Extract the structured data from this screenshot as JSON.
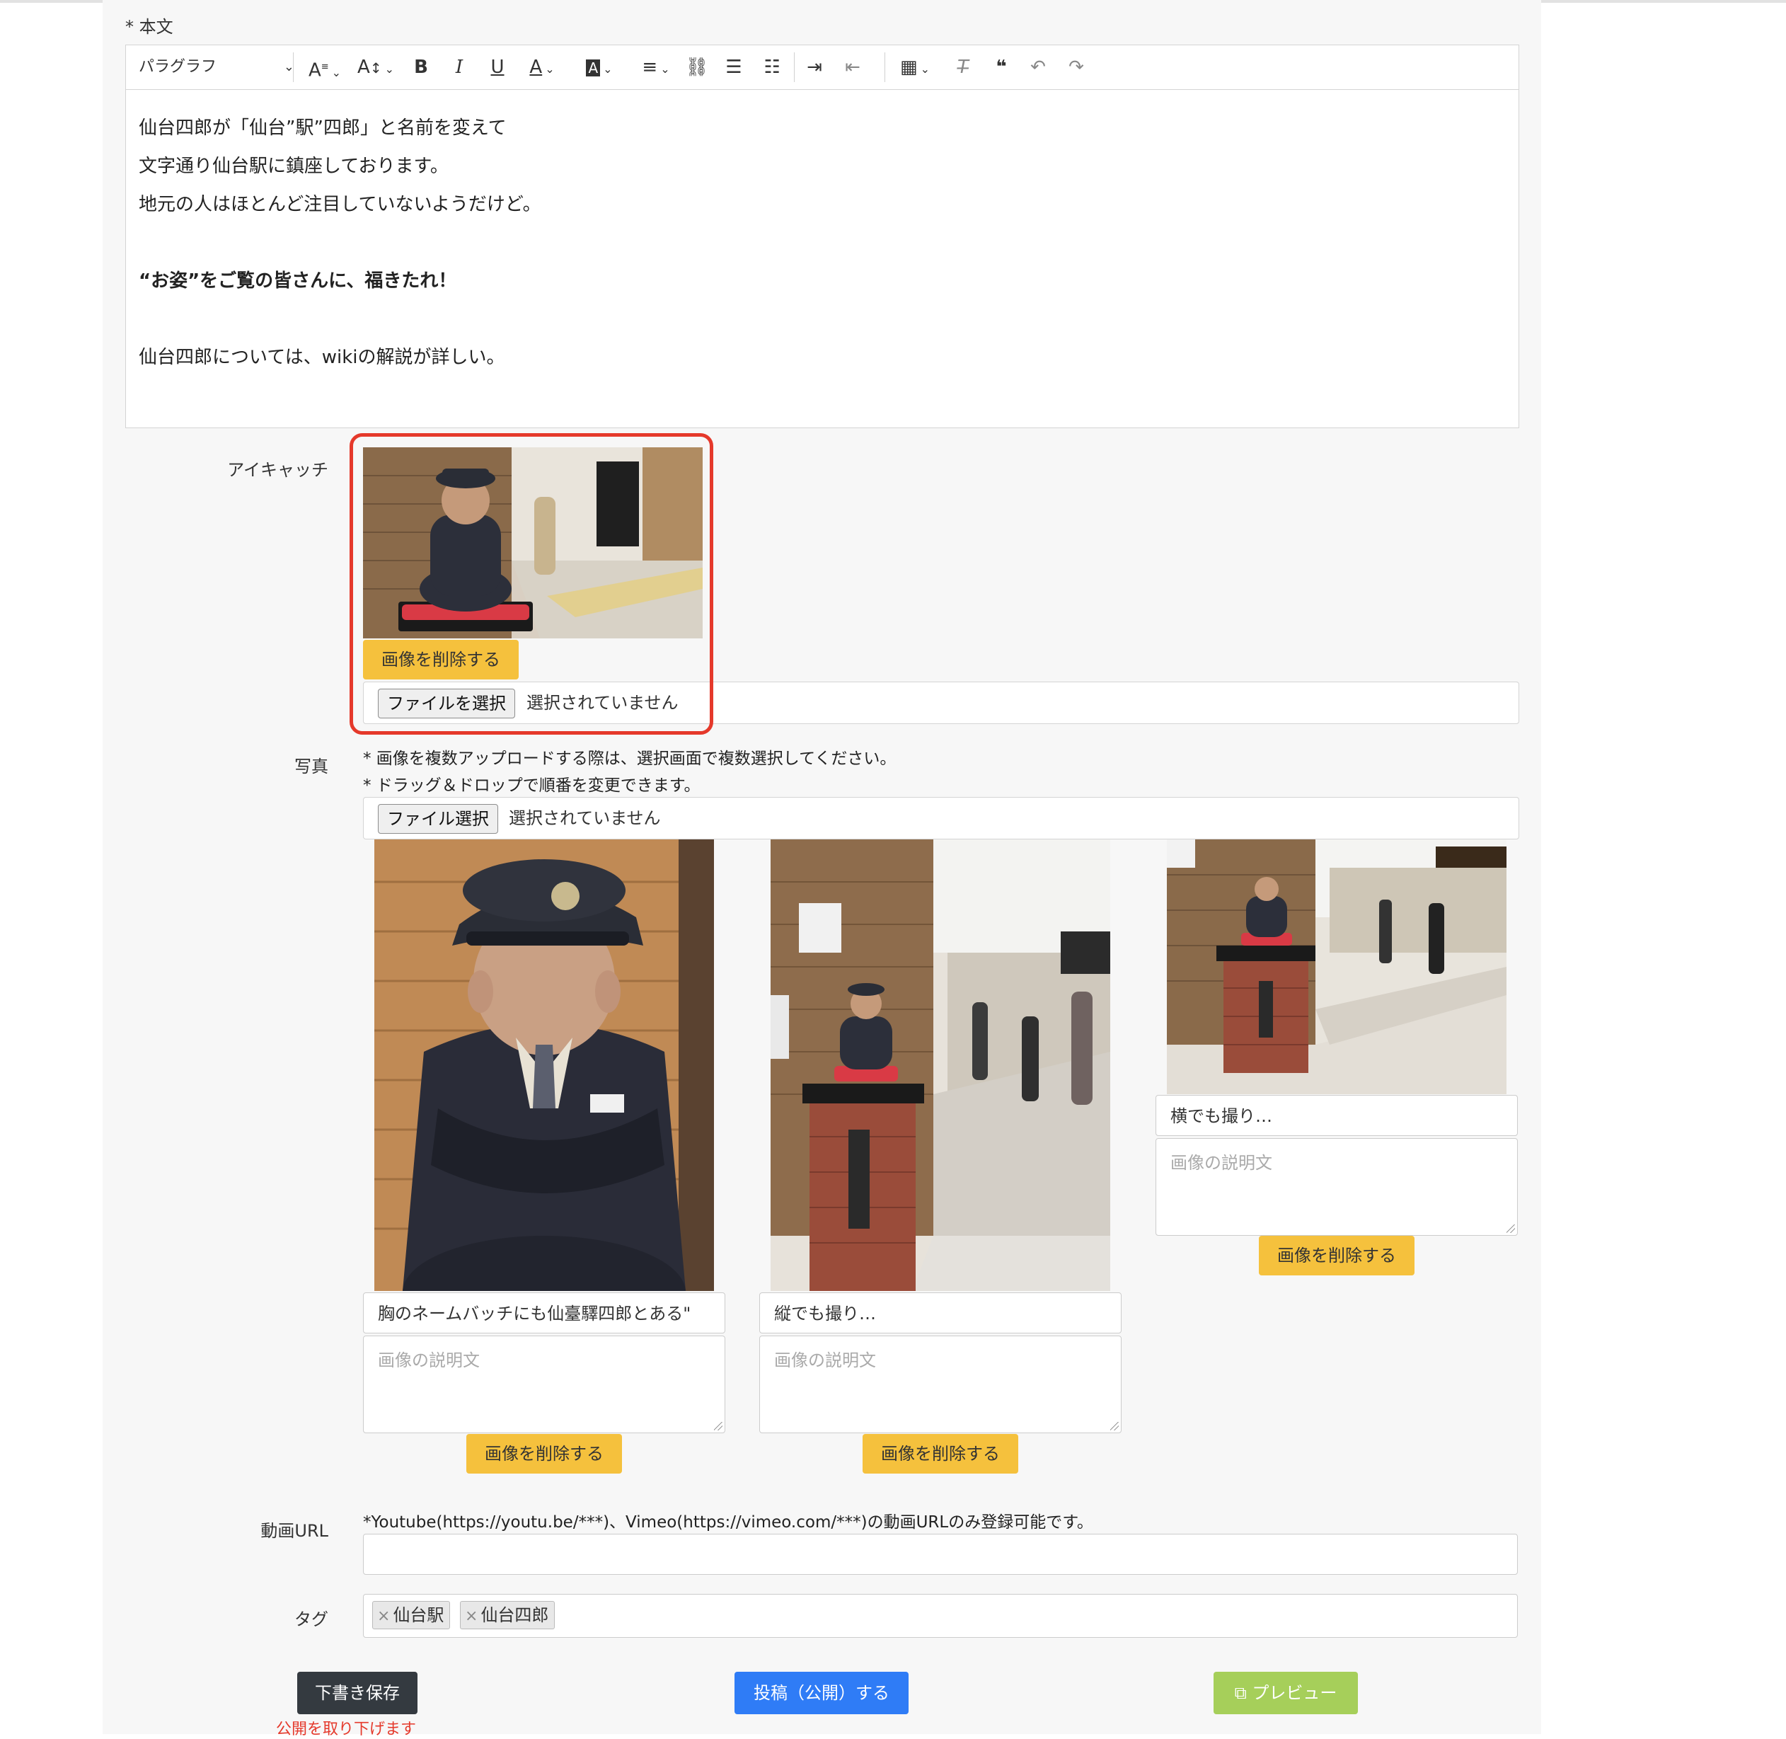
{
  "body_label": "* 本文",
  "toolbar": {
    "paragraph": "パラグラフ",
    "buttons": [
      "A",
      "A",
      "B",
      "I",
      "U",
      "A",
      "A"
    ]
  },
  "editor_lines": [
    "仙台四郎が「仙台”駅”四郎」と名前を変えて",
    "文字通り仙台駅に鎮座しております。",
    "地元の人はほとんど注目していないようだけど。",
    "",
    "“お姿”をご覧の皆さんに、福きたれ！",
    "",
    "仙台四郎については、wikiの解説が詳しい。"
  ],
  "eyecatch": {
    "label": "アイキャッチ",
    "delete_label": "画像を削除する",
    "file_button": "ファイルを選択",
    "file_status": "選択されていません"
  },
  "photos": {
    "label": "写真",
    "notes": [
      "* 画像を複数アップロードする際は、選択画面で複数選択してください。",
      "* ドラッグ＆ドロップで順番を変更できます。"
    ],
    "file_button": "ファイル選択",
    "file_status": "選択されていません",
    "items": [
      {
        "caption": "胸のネームバッチにも仙臺驛四郎とある\"",
        "desc_placeholder": "画像の説明文",
        "delete_label": "画像を削除する"
      },
      {
        "caption": "縦でも撮り…",
        "desc_placeholder": "画像の説明文",
        "delete_label": "画像を削除する"
      },
      {
        "caption": "横でも撮り…",
        "desc_placeholder": "画像の説明文",
        "delete_label": "画像を削除する"
      }
    ]
  },
  "video": {
    "label": "動画URL",
    "note": "*Youtube(https://youtu.be/***)、Vimeo(https://vimeo.com/***)の動画URLのみ登録可能です。",
    "value": ""
  },
  "tags": {
    "label": "タグ",
    "items": [
      "仙台駅",
      "仙台四郎"
    ],
    "remove_symbol": "×"
  },
  "actions": {
    "draft": "下書き保存",
    "unpublish_note": "公開を取り下げます",
    "publish": "投稿（公開）する",
    "preview": "プレビュー"
  },
  "colors": {
    "warning": "#f5c13d",
    "primary": "#2f7cf6",
    "dark": "#343a40",
    "preview": "#a6cf5a",
    "highlight": "#e5392b"
  }
}
